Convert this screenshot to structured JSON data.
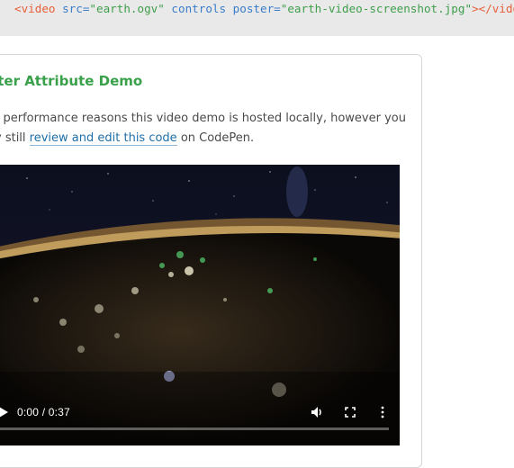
{
  "code_snippet": {
    "open_tag": "<video",
    "attr_src": " src=",
    "val_src": "\"earth.ogv\"",
    "attr_controls": " controls",
    "attr_poster": " poster=",
    "val_poster": "\"earth-video-screenshot.jpg\"",
    "close": "></video>"
  },
  "demo": {
    "title": "oster Attribute Demo",
    "line1": "r performance reasons this video demo is hosted locally, however you",
    "line2_before": "y still ",
    "link_text": "review and edit this code",
    "line2_after": " on CodePen."
  },
  "video": {
    "time_display": "0:00 / 0:37",
    "progress_fraction": 0.0,
    "icons": {
      "play": "play-icon",
      "volume": "volume-icon",
      "fullscreen": "fullscreen-icon",
      "more": "more-vertical-icon"
    }
  },
  "colors": {
    "title_green": "#3aa14b",
    "link_blue": "#1f6fa8",
    "code_bg": "#e9e9ea"
  }
}
